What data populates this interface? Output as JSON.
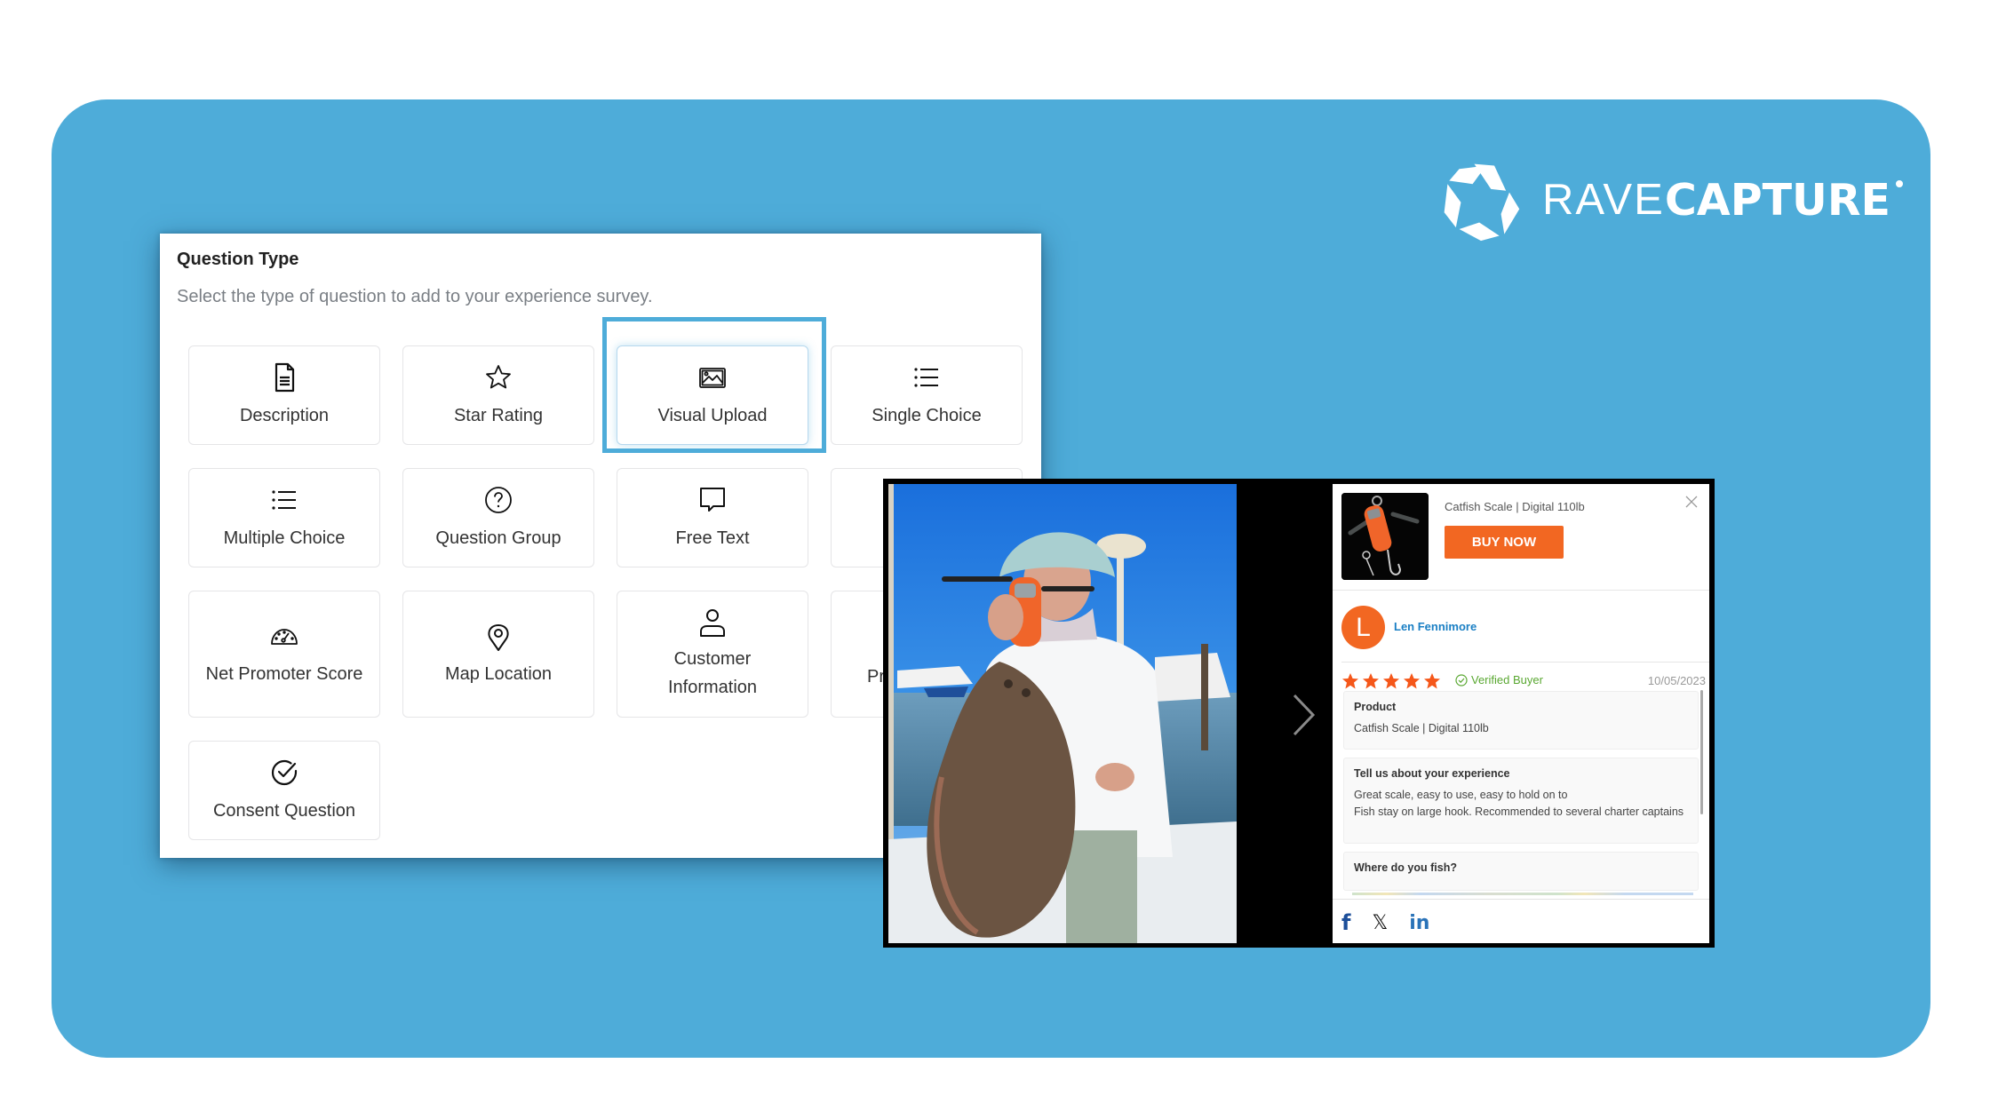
{
  "brand": {
    "name_light": "RAVE",
    "name_bold": "CAPTURE",
    "icon": "star-pinwheel-logo-icon",
    "background_color": "#4eacd9"
  },
  "question_panel": {
    "title": "Question Type",
    "subtitle": "Select the type of question to add to your experience survey.",
    "selected": "Visual Upload",
    "cards": [
      {
        "label": "Description",
        "icon": "document-icon"
      },
      {
        "label": "Star Rating",
        "icon": "star-icon"
      },
      {
        "label": "Visual Upload",
        "icon": "image-icon"
      },
      {
        "label": "Single Choice",
        "icon": "list-icon"
      },
      {
        "label": "Multiple Choice",
        "icon": "list-icon"
      },
      {
        "label": "Question Group",
        "icon": "question-circle-icon"
      },
      {
        "label": "Free Text",
        "icon": "chat-bubble-icon"
      },
      {
        "label": "",
        "icon": ""
      },
      {
        "label": "Net Promoter Score",
        "icon": "gauge-icon"
      },
      {
        "label": "Map Location",
        "icon": "map-pin-icon"
      },
      {
        "label": "Customer Information",
        "icon": "user-icon"
      },
      {
        "label": "Pr",
        "icon": ""
      },
      {
        "label": "Consent Question",
        "icon": "check-circle-icon"
      }
    ]
  },
  "review": {
    "product_name": "Catfish Scale | Digital 110lb",
    "buy_now_label": "BUY NOW",
    "reviewer_initial": "L",
    "reviewer_name": "Len Fennimore",
    "rating": 5,
    "rating_max": 5,
    "verified_label": "Verified Buyer",
    "date": "10/05/2023",
    "answers": [
      {
        "question": "Product",
        "answer": "Catfish Scale | Digital 110lb"
      },
      {
        "question": "Tell us about your experience",
        "answer_lines": [
          "Great scale, easy to use, easy to hold on to",
          "Fish stay on large hook.  Recommended to several charter captains"
        ]
      },
      {
        "question": "Where do you fish?",
        "answer": ""
      }
    ],
    "share": {
      "facebook": "f",
      "x": "𝕏",
      "linkedin": "in"
    },
    "accent_color": "#f26722",
    "link_color": "#1a7fc4",
    "verified_color": "#5aa832"
  }
}
